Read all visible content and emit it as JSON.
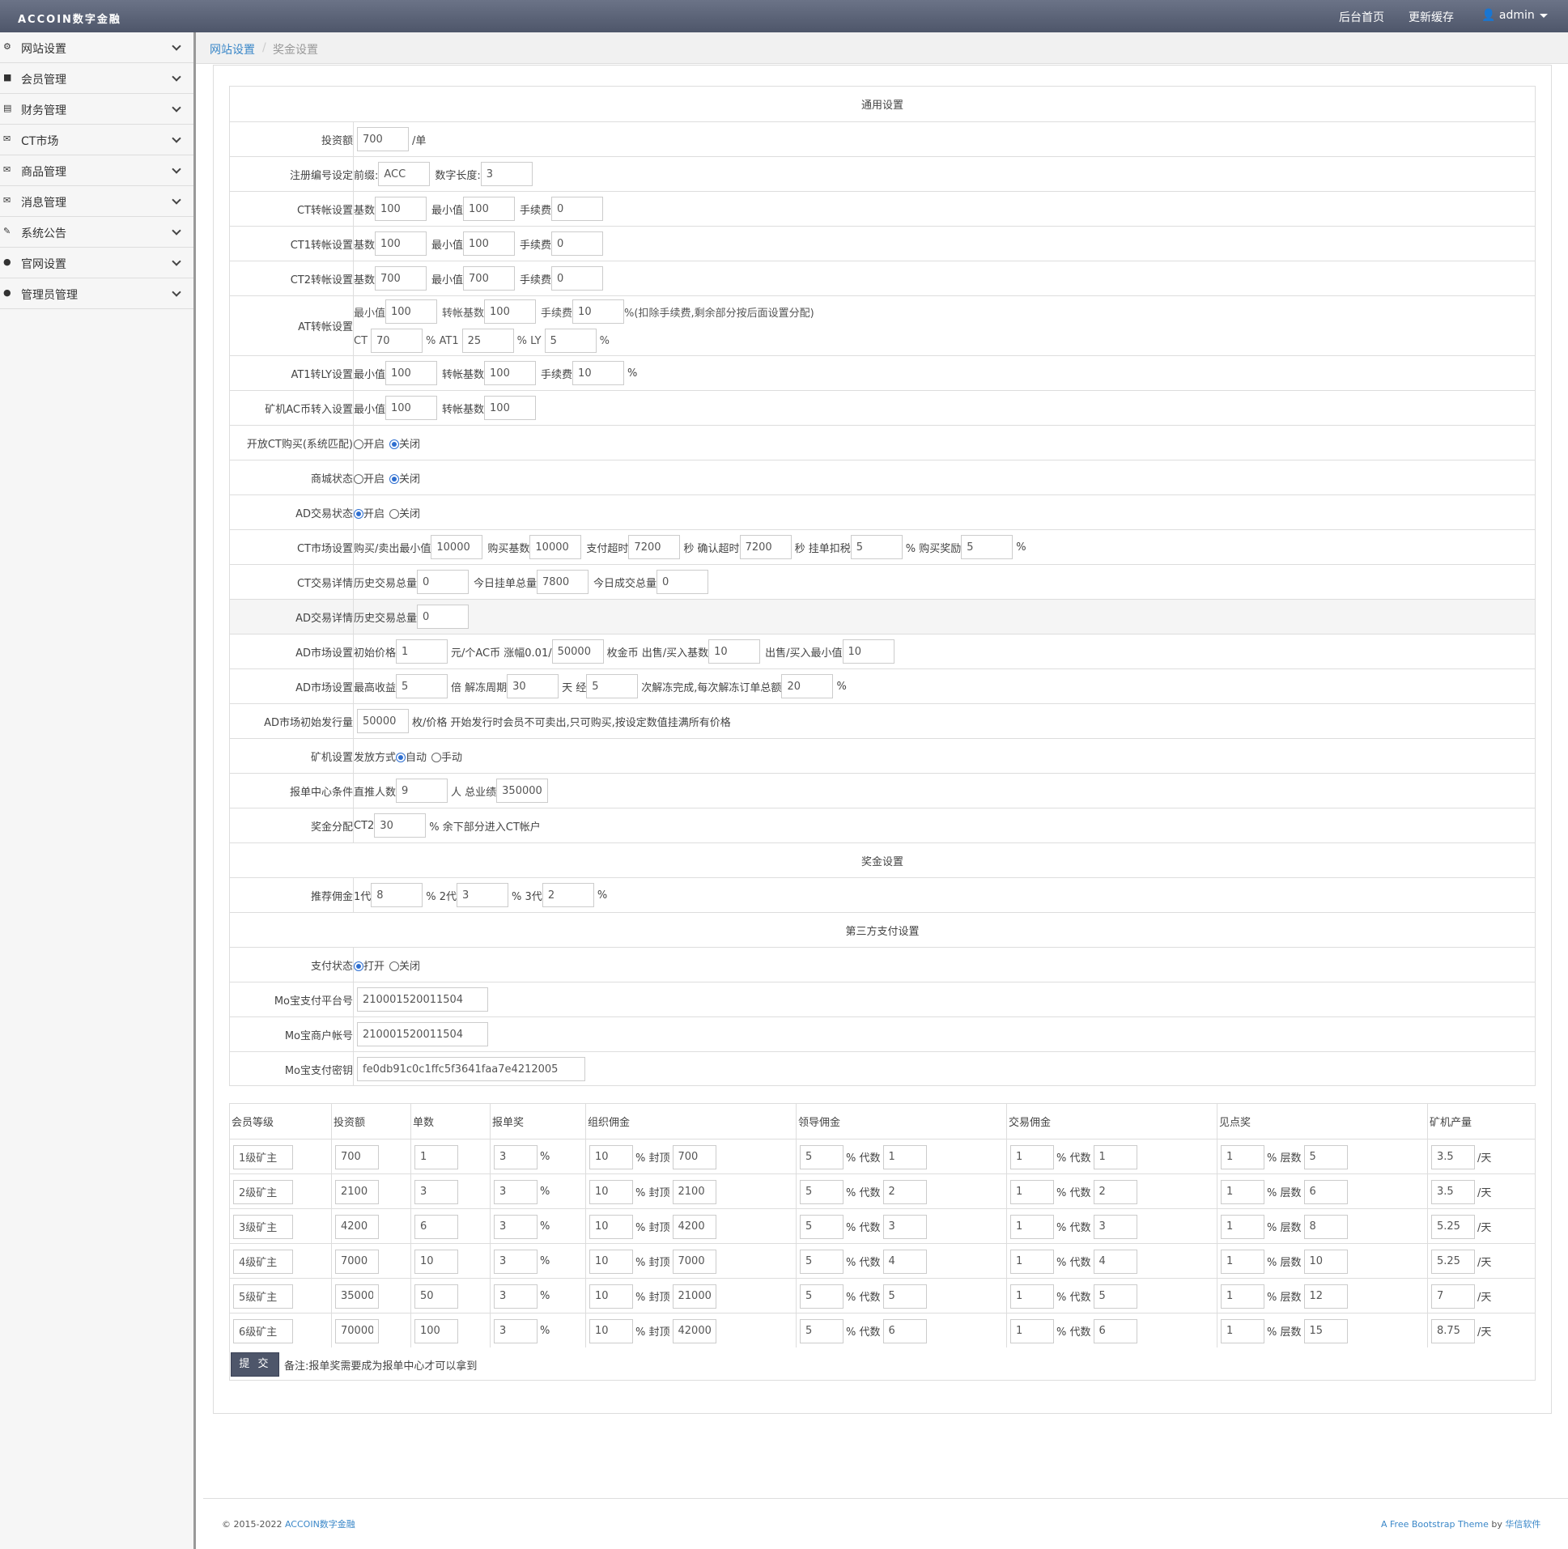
{
  "topbar": {
    "brand": "ACCOIN数字金融",
    "home": "后台首页",
    "cache": "更新缓存",
    "user": "admin"
  },
  "sidebar": {
    "items": [
      {
        "label": "网站设置",
        "icon": "cogs-icon"
      },
      {
        "label": "会员管理",
        "icon": "briefcase-icon"
      },
      {
        "label": "财务管理",
        "icon": "credit-card-icon"
      },
      {
        "label": "CT市场",
        "icon": "envelope-icon"
      },
      {
        "label": "商品管理",
        "icon": "envelope-icon"
      },
      {
        "label": "消息管理",
        "icon": "envelope-icon"
      },
      {
        "label": "系统公告",
        "icon": "edit-icon"
      },
      {
        "label": "官网设置",
        "icon": "comment-icon"
      },
      {
        "label": "管理员管理",
        "icon": "user-icon"
      }
    ]
  },
  "breadcrumb": {
    "first": "网站设置",
    "sep": "/",
    "second": "奖金设置"
  },
  "form": {
    "general_title": "通用设置",
    "invest": {
      "label": "投资额",
      "value": "700",
      "unit": "/单"
    },
    "regno": {
      "label": "注册编号设定",
      "prefix_label": "前缀:",
      "prefix": "ACC",
      "len_label": "数字长度:",
      "len": "3"
    },
    "ct": {
      "label": "CT转帐设置",
      "base_label": "基数",
      "base": "100",
      "min_label": "最小值",
      "min": "100",
      "fee_label": "手续费",
      "fee": "0"
    },
    "ct1": {
      "label": "CT1转帐设置",
      "base_label": "基数",
      "base": "100",
      "min_label": "最小值",
      "min": "100",
      "fee_label": "手续费",
      "fee": "0"
    },
    "ct2": {
      "label": "CT2转帐设置",
      "base_label": "基数",
      "base": "700",
      "min_label": "最小值",
      "min": "700",
      "fee_label": "手续费",
      "fee": "0"
    },
    "at": {
      "label": "AT转帐设置",
      "min_label": "最小值",
      "min": "100",
      "base_label": "转帐基数",
      "base": "100",
      "fee_label": "手续费",
      "fee": "10",
      "fee_note": "%(扣除手续费,剩余部分按后面设置分配)",
      "ct_label": "CT",
      "ct": "70",
      "at1_label": "% AT1",
      "at1": "25",
      "ly_label": "% LY",
      "ly": "5",
      "pct": "%"
    },
    "at1ly": {
      "label": "AT1转LY设置",
      "min_label": "最小值",
      "min": "100",
      "base_label": "转帐基数",
      "base": "100",
      "fee_label": "手续费",
      "fee": "10",
      "pct": "%"
    },
    "ac": {
      "label": "矿机AC币转入设置",
      "min_label": "最小值",
      "min": "100",
      "base_label": "转帐基数",
      "base": "100"
    },
    "openct": {
      "label": "开放CT购买(系统匹配)",
      "on": "开启",
      "off": "关闭"
    },
    "mall": {
      "label": "商城状态",
      "on": "开启",
      "off": "关闭"
    },
    "adtrade": {
      "label": "AD交易状态",
      "on": "开启",
      "off": "关闭"
    },
    "ctmarket": {
      "label": "CT市场设置",
      "a": "购买/卖出最小值",
      "av": "10000",
      "b": "购买基数",
      "bv": "10000",
      "c": "支付超时",
      "cv": "7200",
      "d": "秒 确认超时",
      "dv": "7200",
      "e": "秒 挂单扣税",
      "ev": "5",
      "f": "% 购买奖励",
      "fv": "5",
      "g": "%"
    },
    "ctdetail": {
      "label": "CT交易详情",
      "a": "历史交易总量",
      "av": "0",
      "b": "今日挂单总量",
      "bv": "7800",
      "c": "今日成交总量",
      "cv": "0"
    },
    "addetail": {
      "label": "AD交易详情",
      "a": "历史交易总量",
      "av": "0"
    },
    "admarket1": {
      "label": "AD市场设置",
      "a": "初始价格",
      "av": "1",
      "b": "元/个AC币 涨幅0.01/",
      "bv": "50000",
      "c": "枚金币 出售/买入基数",
      "cv": "10",
      "d": "出售/买入最小值",
      "dv": "10"
    },
    "admarket2": {
      "label": "AD市场设置",
      "a": "最高收益",
      "av": "5",
      "b": "倍 解冻周期",
      "bv": "30",
      "c": "天 经",
      "cv": "5",
      "d": "次解冻完成,每次解冻订单总额",
      "dv": "20",
      "e": "%"
    },
    "adissue": {
      "label": "AD市场初始发行量",
      "value": "50000",
      "note": "枚/价格 开始发行时会员不可卖出,只可购买,按设定数值挂满所有价格"
    },
    "miner": {
      "label": "矿机设置",
      "a": "发放方式",
      "on": "自动",
      "off": "手动"
    },
    "center": {
      "label": "报单中心条件",
      "a": "直推人数",
      "av": "9",
      "b": "人 总业绩",
      "bv": "350000"
    },
    "bonus": {
      "label": "奖金分配",
      "a": "CT2",
      "av": "30",
      "b": "% 余下部分进入CT帐户"
    },
    "bonus_title": "奖金设置",
    "refer": {
      "label": "推荐佣金",
      "a": "1代",
      "av": "8",
      "b": "% 2代",
      "bv": "3",
      "c": "% 3代",
      "cv": "2",
      "d": "%"
    },
    "pay_title": "第三方支付设置",
    "paystatus": {
      "label": "支付状态",
      "on": "打开",
      "off": "关闭"
    },
    "moplat": {
      "label": "Mo宝支付平台号",
      "value": "210001520011504"
    },
    "momerch": {
      "label": "Mo宝商户帐号",
      "value": "210001520011504"
    },
    "mokey": {
      "label": "Mo宝支付密钥",
      "value": "fe0db91c0c1ffc5f3641faa7e4212005"
    }
  },
  "levels": {
    "headers": [
      "会员等级",
      "投资额",
      "单数",
      "报单奖",
      "组织佣金",
      "领导佣金",
      "交易佣金",
      "见点奖",
      "矿机产量"
    ],
    "pct": "%",
    "cap": "% 封顶",
    "gen": "% 代数",
    "layer": "% 层数",
    "day": "/天",
    "rows": [
      {
        "name": "1级矿主",
        "invest": "700",
        "count": "1",
        "rep": "3",
        "org": "10",
        "cap": "700",
        "lead": "5",
        "lg": "1",
        "tr": "1",
        "tg": "1",
        "pt": "1",
        "pl": "5",
        "mine": "3.5"
      },
      {
        "name": "2级矿主",
        "invest": "2100",
        "count": "3",
        "rep": "3",
        "org": "10",
        "cap": "2100",
        "lead": "5",
        "lg": "2",
        "tr": "1",
        "tg": "2",
        "pt": "1",
        "pl": "6",
        "mine": "3.5"
      },
      {
        "name": "3级矿主",
        "invest": "4200",
        "count": "6",
        "rep": "3",
        "org": "10",
        "cap": "4200",
        "lead": "5",
        "lg": "3",
        "tr": "1",
        "tg": "3",
        "pt": "1",
        "pl": "8",
        "mine": "5.25"
      },
      {
        "name": "4级矿主",
        "invest": "7000",
        "count": "10",
        "rep": "3",
        "org": "10",
        "cap": "7000",
        "lead": "5",
        "lg": "4",
        "tr": "1",
        "tg": "4",
        "pt": "1",
        "pl": "10",
        "mine": "5.25"
      },
      {
        "name": "5级矿主",
        "invest": "35000",
        "count": "50",
        "rep": "3",
        "org": "10",
        "cap": "21000",
        "lead": "5",
        "lg": "5",
        "tr": "1",
        "tg": "5",
        "pt": "1",
        "pl": "12",
        "mine": "7"
      },
      {
        "name": "6级矿主",
        "invest": "70000",
        "count": "100",
        "rep": "3",
        "org": "10",
        "cap": "42000",
        "lead": "5",
        "lg": "6",
        "tr": "1",
        "tg": "6",
        "pt": "1",
        "pl": "15",
        "mine": "8.75"
      }
    ],
    "submit": "提 交",
    "note": "备注:报单奖需要成为报单中心才可以拿到"
  },
  "footer": {
    "copy": "© 2015-2022",
    "brand": "ACCOIN数字金融",
    "theme": "A Free Bootstrap Theme",
    "by": "by",
    "author": "华信软件"
  }
}
